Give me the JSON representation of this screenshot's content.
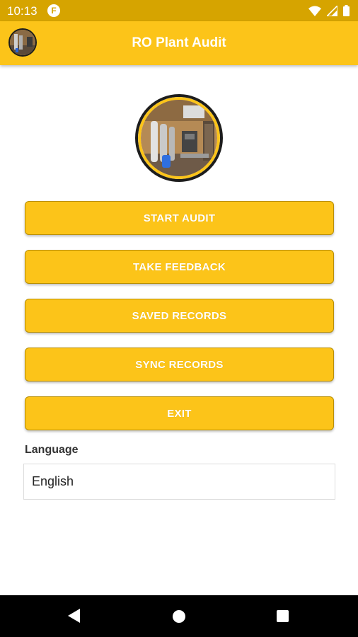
{
  "status": {
    "time": "10:13",
    "notification_icon": "F"
  },
  "appbar": {
    "title": "RO Plant Audit"
  },
  "menu": [
    {
      "label": "START AUDIT"
    },
    {
      "label": "TAKE FEEDBACK"
    },
    {
      "label": "SAVED RECORDS"
    },
    {
      "label": "SYNC RECORDS"
    },
    {
      "label": "EXIT"
    }
  ],
  "language": {
    "label": "Language",
    "value": "English"
  },
  "colors": {
    "accent": "#fcc419",
    "statusbar": "#d6a400"
  }
}
